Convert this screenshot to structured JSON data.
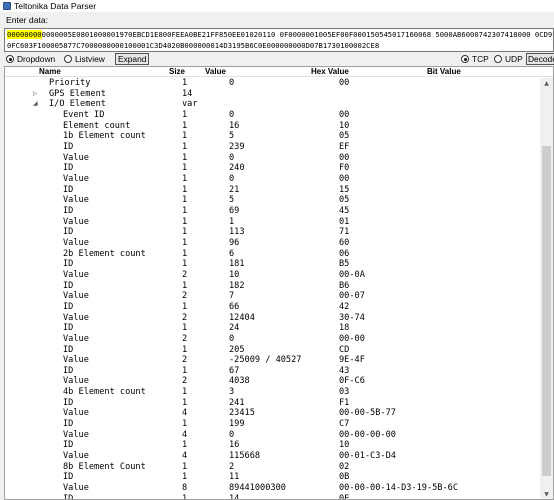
{
  "window": {
    "title": "Teltonika Data Parser"
  },
  "input": {
    "label": "Enter data:",
    "line1_highlight": "00000000",
    "line1_rest": "0000005E0801000001970EBCD1E800FEEA0BE21FF850EE01020110 0F0000001005EF00F000150545017160068 5000AB6000742307418000 0CD9E4F43",
    "line2": "0FC603F100005877C7000000000100001C3D4020B000000014D3195B6C0E000000000D07B1730100002CE8"
  },
  "toolbar": {
    "dropdown_label": "Dropdown",
    "listview_label": "Listview",
    "expand_label": "Expand",
    "tcp_label": "TCP",
    "udp_label": "UDP",
    "decode_label": "Decode"
  },
  "grid": {
    "columns": {
      "name": "Name",
      "size": "Size",
      "value": "Value",
      "hex": "Hex Value",
      "bit": "Bit Value"
    },
    "rows": [
      {
        "name": "Priority",
        "size": "1",
        "value": "0",
        "hex": "00",
        "level": 1,
        "node": ""
      },
      {
        "name": "GPS Element",
        "size": "14",
        "value": "",
        "hex": "",
        "level": 1,
        "node": "collapsed"
      },
      {
        "name": "I/O Element",
        "size": "var",
        "value": "",
        "hex": "",
        "level": 1,
        "node": "expanded"
      },
      {
        "name": "Event ID",
        "size": "1",
        "value": "0",
        "hex": "00",
        "level": 2,
        "node": ""
      },
      {
        "name": "Element count",
        "size": "1",
        "value": "16",
        "hex": "10",
        "level": 2,
        "node": ""
      },
      {
        "name": "1b Element count",
        "size": "1",
        "value": "5",
        "hex": "05",
        "level": 2,
        "node": ""
      },
      {
        "name": "ID",
        "size": "1",
        "value": "239",
        "hex": "EF",
        "level": 2,
        "node": ""
      },
      {
        "name": "Value",
        "size": "1",
        "value": "0",
        "hex": "00",
        "level": 2,
        "node": ""
      },
      {
        "name": "ID",
        "size": "1",
        "value": "240",
        "hex": "F0",
        "level": 2,
        "node": ""
      },
      {
        "name": "Value",
        "size": "1",
        "value": "0",
        "hex": "00",
        "level": 2,
        "node": ""
      },
      {
        "name": "ID",
        "size": "1",
        "value": "21",
        "hex": "15",
        "level": 2,
        "node": ""
      },
      {
        "name": "Value",
        "size": "1",
        "value": "5",
        "hex": "05",
        "level": 2,
        "node": ""
      },
      {
        "name": "ID",
        "size": "1",
        "value": "69",
        "hex": "45",
        "level": 2,
        "node": ""
      },
      {
        "name": "Value",
        "size": "1",
        "value": "1",
        "hex": "01",
        "level": 2,
        "node": ""
      },
      {
        "name": "ID",
        "size": "1",
        "value": "113",
        "hex": "71",
        "level": 2,
        "node": ""
      },
      {
        "name": "Value",
        "size": "1",
        "value": "96",
        "hex": "60",
        "level": 2,
        "node": ""
      },
      {
        "name": "2b Element count",
        "size": "1",
        "value": "6",
        "hex": "06",
        "level": 2,
        "node": ""
      },
      {
        "name": "ID",
        "size": "1",
        "value": "181",
        "hex": "B5",
        "level": 2,
        "node": ""
      },
      {
        "name": "Value",
        "size": "2",
        "value": "10",
        "hex": "00-0A",
        "level": 2,
        "node": ""
      },
      {
        "name": "ID",
        "size": "1",
        "value": "182",
        "hex": "B6",
        "level": 2,
        "node": ""
      },
      {
        "name": "Value",
        "size": "2",
        "value": "7",
        "hex": "00-07",
        "level": 2,
        "node": ""
      },
      {
        "name": "ID",
        "size": "1",
        "value": "66",
        "hex": "42",
        "level": 2,
        "node": ""
      },
      {
        "name": "Value",
        "size": "2",
        "value": "12404",
        "hex": "30-74",
        "level": 2,
        "node": ""
      },
      {
        "name": "ID",
        "size": "1",
        "value": "24",
        "hex": "18",
        "level": 2,
        "node": ""
      },
      {
        "name": "Value",
        "size": "2",
        "value": "0",
        "hex": "00-00",
        "level": 2,
        "node": ""
      },
      {
        "name": "ID",
        "size": "1",
        "value": "205",
        "hex": "CD",
        "level": 2,
        "node": ""
      },
      {
        "name": "Value",
        "size": "2",
        "value": "-25009 / 40527",
        "hex": "9E-4F",
        "level": 2,
        "node": ""
      },
      {
        "name": "ID",
        "size": "1",
        "value": "67",
        "hex": "43",
        "level": 2,
        "node": ""
      },
      {
        "name": "Value",
        "size": "2",
        "value": "4038",
        "hex": "0F-C6",
        "level": 2,
        "node": ""
      },
      {
        "name": "4b Element count",
        "size": "1",
        "value": "3",
        "hex": "03",
        "level": 2,
        "node": ""
      },
      {
        "name": "ID",
        "size": "1",
        "value": "241",
        "hex": "F1",
        "level": 2,
        "node": ""
      },
      {
        "name": "Value",
        "size": "4",
        "value": "23415",
        "hex": "00-00-5B-77",
        "level": 2,
        "node": ""
      },
      {
        "name": "ID",
        "size": "1",
        "value": "199",
        "hex": "C7",
        "level": 2,
        "node": ""
      },
      {
        "name": "Value",
        "size": "4",
        "value": "0",
        "hex": "00-00-00-00",
        "level": 2,
        "node": ""
      },
      {
        "name": "ID",
        "size": "1",
        "value": "16",
        "hex": "10",
        "level": 2,
        "node": ""
      },
      {
        "name": "Value",
        "size": "4",
        "value": "115668",
        "hex": "00-01-C3-D4",
        "level": 2,
        "node": ""
      },
      {
        "name": "8b Element Count",
        "size": "1",
        "value": "2",
        "hex": "02",
        "level": 2,
        "node": ""
      },
      {
        "name": "ID",
        "size": "1",
        "value": "11",
        "hex": "0B",
        "level": 2,
        "node": ""
      },
      {
        "name": "Value",
        "size": "8",
        "value": "89441000300",
        "hex": "00-00-00-14-D3-19-5B-6C",
        "level": 2,
        "node": ""
      },
      {
        "name": "ID",
        "size": "1",
        "value": "14",
        "hex": "0E",
        "level": 2,
        "node": ""
      }
    ]
  },
  "icons": {
    "app": "app-icon",
    "collapsed": "tree-collapsed-icon",
    "expanded": "tree-expanded-icon"
  }
}
